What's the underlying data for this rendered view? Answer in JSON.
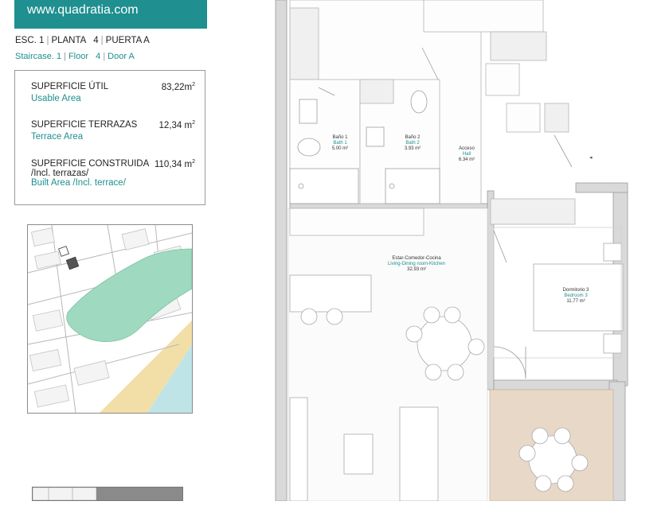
{
  "header": {
    "website": "www.quadratia.com"
  },
  "unit_es": {
    "staircase": "ESC. 1",
    "floor": "PLANTA   4",
    "door": "PUERTA A"
  },
  "unit_en": {
    "staircase": "Staircase. 1",
    "floor": "Floor   4",
    "door": "Door A"
  },
  "areas": [
    {
      "label": "SUPERFICIE ÚTIL",
      "label2": "",
      "label_en": "Usable Area",
      "value": "83,22m",
      "unit_sup": "2"
    },
    {
      "label": "SUPERFICIE TERRAZAS",
      "label2": "",
      "label_en": "Terrace Area",
      "value": "12,34 m",
      "unit_sup": "2"
    },
    {
      "label": "SUPERFICIE CONSTRUIDA",
      "label2": "/Incl. terrazas/",
      "label_en": "Built Area /Incl. terrace/",
      "value": "110,34 m",
      "unit_sup": "2"
    }
  ],
  "rooms": {
    "bath1": {
      "name": "Baño 1",
      "name_en": "Bath 1",
      "area": "5.00 m²"
    },
    "bath2": {
      "name": "Baño 2",
      "name_en": "Bath 2",
      "area": "3.93 m²"
    },
    "hall": {
      "name": "Acceso",
      "name_en": "Hall",
      "area": "6.34 m²"
    },
    "living": {
      "name": "Estar-Comedor-Cocina",
      "name_en": "Living-Dining room-Kitchen",
      "area": "32.93 m²"
    },
    "bedroom3": {
      "name": "Dormitorio 3",
      "name_en": "Bedroom 3",
      "area": "11.77 m²"
    }
  },
  "colors": {
    "brand": "#1f8f8f",
    "terrace": "#e8d8c8",
    "greenery": "#9fd9bf",
    "beach": "#f2dfa8",
    "sea": "#bfe4e8"
  }
}
